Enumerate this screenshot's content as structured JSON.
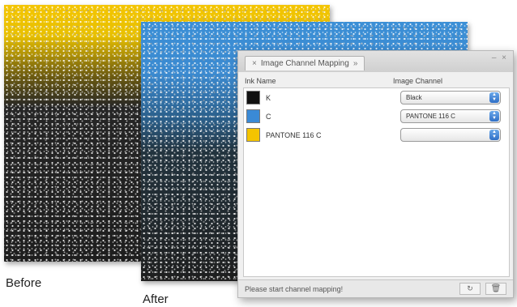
{
  "captions": {
    "before": "Before",
    "after": "After"
  },
  "dialog": {
    "tab_title": "Image Channel Mapping",
    "close_glyph": "×",
    "tab_arrow_glyph": "»",
    "window_controls": "– ×",
    "columns": {
      "ink": "Ink Name",
      "channel": "Image Channel"
    },
    "rows": [
      {
        "ink": "K",
        "swatch_color": "#111111",
        "channel": "Black"
      },
      {
        "ink": "C",
        "swatch_color": "#3a8ad6",
        "channel": "PANTONE 116 C"
      },
      {
        "ink": "PANTONE 116 C",
        "swatch_color": "#f4c400",
        "channel": ""
      }
    ],
    "status": "Please start channel mapping!",
    "status_buttons": [
      "↻",
      "🗑"
    ]
  },
  "colors": {
    "yellow": "#f4c500",
    "blue": "#3b8fd6",
    "accent": "#2f6fc6"
  }
}
